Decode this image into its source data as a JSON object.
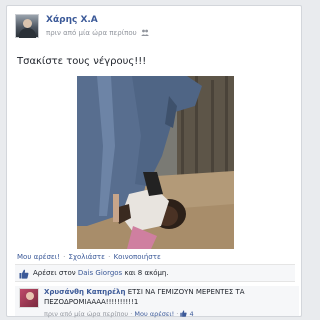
{
  "post": {
    "author": "Χάρης Χ.Α",
    "time": "πριν από μία ώρα περίπου",
    "text": "Τσακίστε τους νέγρους!!!"
  },
  "actions": {
    "like": "Μου αρέσει!",
    "comment": "Σχολιάστε",
    "share": "Κοινοποιήστε",
    "separator": "·"
  },
  "likes": {
    "prefix": "Αρέσει στον",
    "name": "Dais Giorgos",
    "suffix": "και 8 ακόμη."
  },
  "comment": {
    "author": "Χρυσάνθη Καπηρέλη",
    "text_line1": "ΕΤΣΙ ΝΑ ΓΕΜΙΖΟΥΝ ΜΕΡΕΝΤΕΣ ΤΑ",
    "text_line2": "ΠΕΖΟΔΡΟΜΙΑΑΑΑ!!!!!!!!!!1",
    "time": "πριν από μία ώρα περίπου",
    "like": "Μου αρέσει!",
    "like_count": "4"
  },
  "colors": {
    "link": "#3b5998",
    "muted": "#90949c"
  },
  "icons": {
    "audience": "people-icon",
    "likes": "thumbs-up-icon"
  }
}
